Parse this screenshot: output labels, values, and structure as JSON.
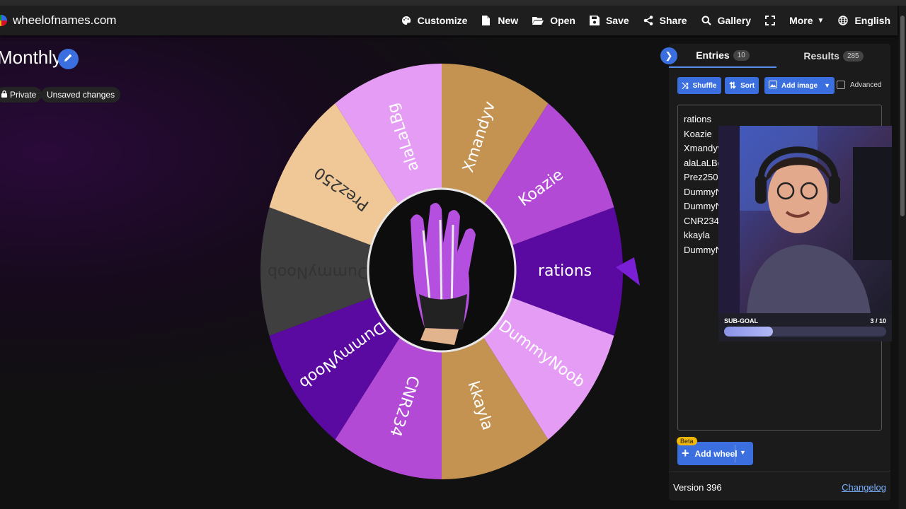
{
  "app": {
    "brand": "wheelofnames.com"
  },
  "nav": {
    "items": [
      {
        "label": "Customize",
        "icon": "palette-icon"
      },
      {
        "label": "New",
        "icon": "new-file-icon"
      },
      {
        "label": "Open",
        "icon": "folder-open-icon"
      },
      {
        "label": "Save",
        "icon": "save-icon"
      },
      {
        "label": "Share",
        "icon": "share-icon"
      },
      {
        "label": "Gallery",
        "icon": "search-icon"
      },
      {
        "label": "",
        "icon": "fullscreen-icon"
      },
      {
        "label": "More",
        "icon": "caret-down-icon"
      },
      {
        "label": "English",
        "icon": "globe-icon"
      }
    ]
  },
  "wheel_header": {
    "title": "Monthly",
    "private_label": "Private",
    "unsaved_label": "Unsaved changes"
  },
  "wheel": {
    "segments": [
      {
        "label": "rations",
        "color": "#5a0aa0"
      },
      {
        "label": "DummyNoob",
        "color": "#e59cf5"
      },
      {
        "label": "kkayla",
        "color": "#c49352"
      },
      {
        "label": "CNR234",
        "color": "#b34ad6"
      },
      {
        "label": "DummyNoob",
        "color": "#5a0aa0"
      },
      {
        "label": "DummyNoob",
        "color": "#3f3f3f"
      },
      {
        "label": "Prez250",
        "color": "#f0c796"
      },
      {
        "label": "alaLaLBg",
        "color": "#e59cf5"
      },
      {
        "label": "Xmandyv",
        "color": "#c49352"
      },
      {
        "label": "Koazie",
        "color": "#b34ad6"
      }
    ],
    "center_image": "purple-glove-image",
    "pointer_color": "#7a1fd6"
  },
  "panel": {
    "tabs": [
      {
        "label": "Entries",
        "count": "10"
      },
      {
        "label": "Results",
        "count": "285"
      }
    ],
    "buttons": {
      "shuffle": "Shuffle",
      "sort": "Sort",
      "add_image": "Add image",
      "advanced": "Advanced"
    },
    "entries": [
      "rations",
      "Koazie",
      "Xmandyv",
      "alaLaLBg",
      "Prez250",
      "DummyN",
      "DummyN",
      "CNR234",
      "kkayla",
      "DummyN"
    ],
    "add_wheel": {
      "label": "Add wheel",
      "badge": "Beta"
    },
    "version": "Version 396",
    "changelog": "Changelog"
  },
  "overlay": {
    "subgoal_label": "SUB-GOAL",
    "subgoal_count": "3 / 10",
    "subgoal_progress": 0.3
  },
  "colors": {
    "accent": "#3b6fe0",
    "link": "#7ab0ff"
  }
}
